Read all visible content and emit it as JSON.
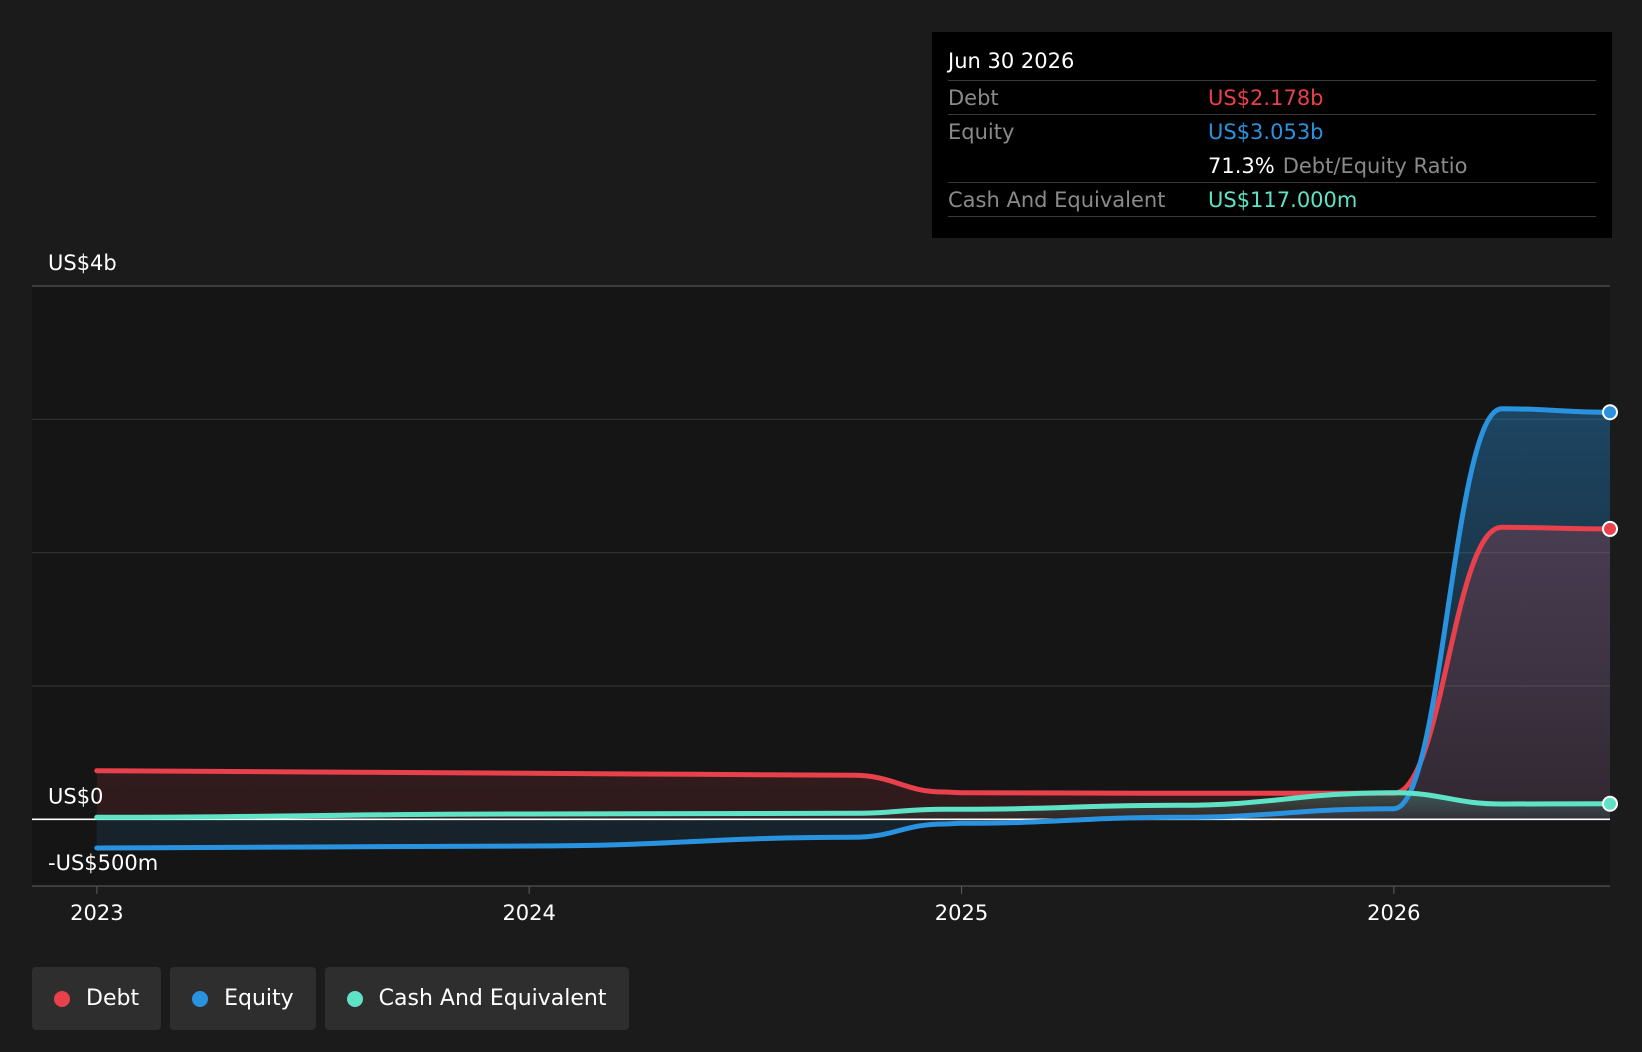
{
  "chart_data": {
    "type": "area",
    "title": "",
    "xlabel": "",
    "ylabel": "",
    "ylim": [
      -500,
      4000
    ],
    "y_unit": "US$ millions",
    "y_tick_labels": [
      "US$4b",
      "US$0",
      "-US$500m"
    ],
    "x_ticks": [
      2023,
      2024,
      2025,
      2026
    ],
    "x_tick_labels": [
      "2023",
      "2024",
      "2025",
      "2026"
    ],
    "grid": true,
    "legend": "bottom-left",
    "x": [
      2023.0,
      2024.0,
      2024.75,
      2024.96,
      2025.0,
      2025.5,
      2026.0,
      2026.25,
      2026.5
    ],
    "series": [
      {
        "name": "Debt",
        "color": "#e8414b",
        "values": [
          365,
          345,
          330,
          205,
          200,
          195,
          195,
          2190,
          2178
        ]
      },
      {
        "name": "Equity",
        "color": "#2a93e0",
        "values": [
          -215,
          -200,
          -135,
          -35,
          -30,
          15,
          80,
          3080,
          3053
        ]
      },
      {
        "name": "Cash And Equivalent",
        "color": "#5fe3c6",
        "values": [
          15,
          40,
          45,
          75,
          75,
          105,
          200,
          115,
          117
        ]
      }
    ]
  },
  "tooltip": {
    "date": "Jun 30 2026",
    "debt_label": "Debt",
    "debt_value": "US$2.178b",
    "equity_label": "Equity",
    "equity_value": "US$3.053b",
    "ratio_value": "71.3%",
    "ratio_label": "Debt/Equity Ratio",
    "cash_label": "Cash And Equivalent",
    "cash_value": "US$117.000m"
  },
  "legend": {
    "items": [
      {
        "label": "Debt",
        "color": "#e8414b"
      },
      {
        "label": "Equity",
        "color": "#2a93e0"
      },
      {
        "label": "Cash And Equivalent",
        "color": "#5fe3c6"
      }
    ]
  }
}
